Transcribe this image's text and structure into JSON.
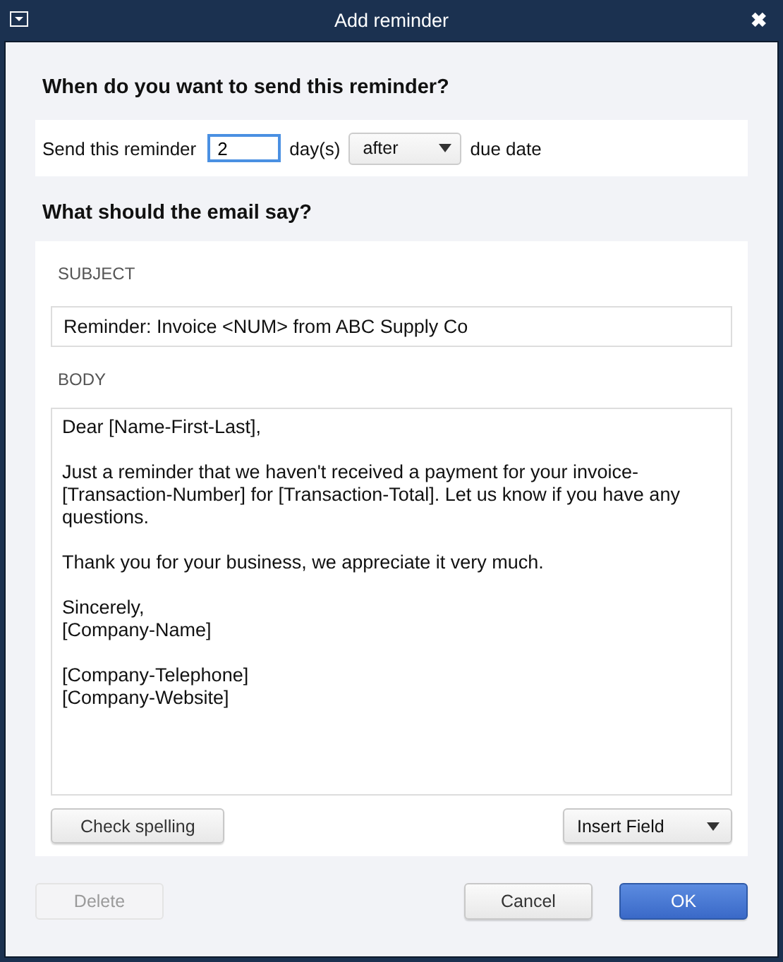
{
  "window": {
    "title": "Add reminder",
    "close": "✖"
  },
  "schedule": {
    "heading": "When do you want to send this reminder?",
    "label": "Send this reminder",
    "days_value": "2",
    "days_unit": "day(s)",
    "relation": "after",
    "suffix": "due date"
  },
  "email": {
    "heading": "What should the email say?",
    "subject_label": "SUBJECT",
    "subject": "Reminder: Invoice <NUM> from ABC Supply Co",
    "body_label": "BODY",
    "body_paragraphs": [
      [
        "Dear [Name-First-Last],"
      ],
      [
        "Just a reminder that we haven't received a payment for your invoice-",
        "[Transaction-Number] for [Transaction-Total]. Let us know if you have any",
        "questions."
      ],
      [
        "Thank you for your business, we appreciate it very much."
      ],
      [
        "Sincerely,",
        "[Company-Name]"
      ],
      [
        "[Company-Telephone]",
        "[Company-Website]"
      ]
    ],
    "check_spelling": "Check spelling",
    "insert_field": "Insert Field"
  },
  "buttons": [
    {
      "label": "Delete",
      "kind": "plain",
      "disabled": true
    },
    {
      "label": "Cancel",
      "kind": "plain",
      "disabled": false
    },
    {
      "label": "OK",
      "kind": "primary",
      "disabled": false
    }
  ]
}
